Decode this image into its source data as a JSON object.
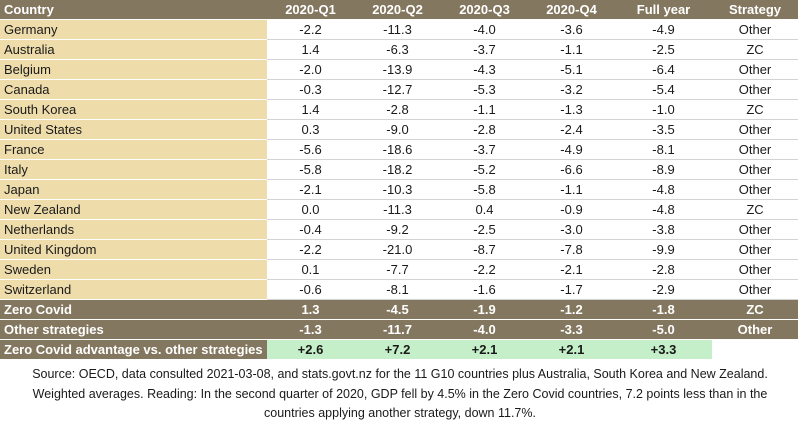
{
  "chart_data": {
    "type": "table",
    "columns": [
      "Country",
      "2020-Q1",
      "2020-Q2",
      "2020-Q3",
      "2020-Q4",
      "Full year",
      "Strategy"
    ],
    "rows": [
      [
        "Germany",
        "-2.2",
        "-11.3",
        "-4.0",
        "-3.6",
        "-4.9",
        "Other"
      ],
      [
        "Australia",
        "1.4",
        "-6.3",
        "-3.7",
        "-1.1",
        "-2.5",
        "ZC"
      ],
      [
        "Belgium",
        "-2.0",
        "-13.9",
        "-4.3",
        "-5.1",
        "-6.4",
        "Other"
      ],
      [
        "Canada",
        "-0.3",
        "-12.7",
        "-5.3",
        "-3.2",
        "-5.4",
        "Other"
      ],
      [
        "South Korea",
        "1.4",
        "-2.8",
        "-1.1",
        "-1.3",
        "-1.0",
        "ZC"
      ],
      [
        "United States",
        "0.3",
        "-9.0",
        "-2.8",
        "-2.4",
        "-3.5",
        "Other"
      ],
      [
        "France",
        "-5.6",
        "-18.6",
        "-3.7",
        "-4.9",
        "-8.1",
        "Other"
      ],
      [
        "Italy",
        "-5.8",
        "-18.2",
        "-5.2",
        "-6.6",
        "-8.9",
        "Other"
      ],
      [
        "Japan",
        "-2.1",
        "-10.3",
        "-5.8",
        "-1.1",
        "-4.8",
        "Other"
      ],
      [
        "New Zealand",
        "0.0",
        "-11.3",
        "0.4",
        "-0.9",
        "-4.8",
        "ZC"
      ],
      [
        "Netherlands",
        "-0.4",
        "-9.2",
        "-2.5",
        "-3.0",
        "-3.8",
        "Other"
      ],
      [
        "United Kingdom",
        "-2.2",
        "-21.0",
        "-8.7",
        "-7.8",
        "-9.9",
        "Other"
      ],
      [
        "Sweden",
        "0.1",
        "-7.7",
        "-2.2",
        "-2.1",
        "-2.8",
        "Other"
      ],
      [
        "Switzerland",
        "-0.6",
        "-8.1",
        "-1.6",
        "-1.7",
        "-2.9",
        "Other"
      ]
    ],
    "summary_rows": [
      [
        "Zero Covid",
        "1.3",
        "-4.5",
        "-1.9",
        "-1.2",
        "-1.8",
        "ZC"
      ],
      [
        "Other strategies",
        "-1.3",
        "-11.7",
        "-4.0",
        "-3.3",
        "-5.0",
        "Other"
      ]
    ],
    "advantage_row": [
      "Zero Covid advantage vs. other strategies",
      "+2.6",
      "+7.2",
      "+2.1",
      "+2.1",
      "+3.3"
    ],
    "source_note": "Source: OECD, data consulted 2021-03-08, and stats.govt.nz for the 11 G10 countries plus Australia, South Korea and New Zealand. Weighted averages. Reading: In the second quarter of 2020, GDP fell by 4.5% in the Zero Covid countries, 7.2 points less than in the countries applying another strategy, down 11.7%."
  },
  "colors": {
    "header_bg": "#84775f",
    "country_bg": "#eedcab",
    "advantage_bg": "#c5efc9",
    "header_text": "#ffffff"
  }
}
